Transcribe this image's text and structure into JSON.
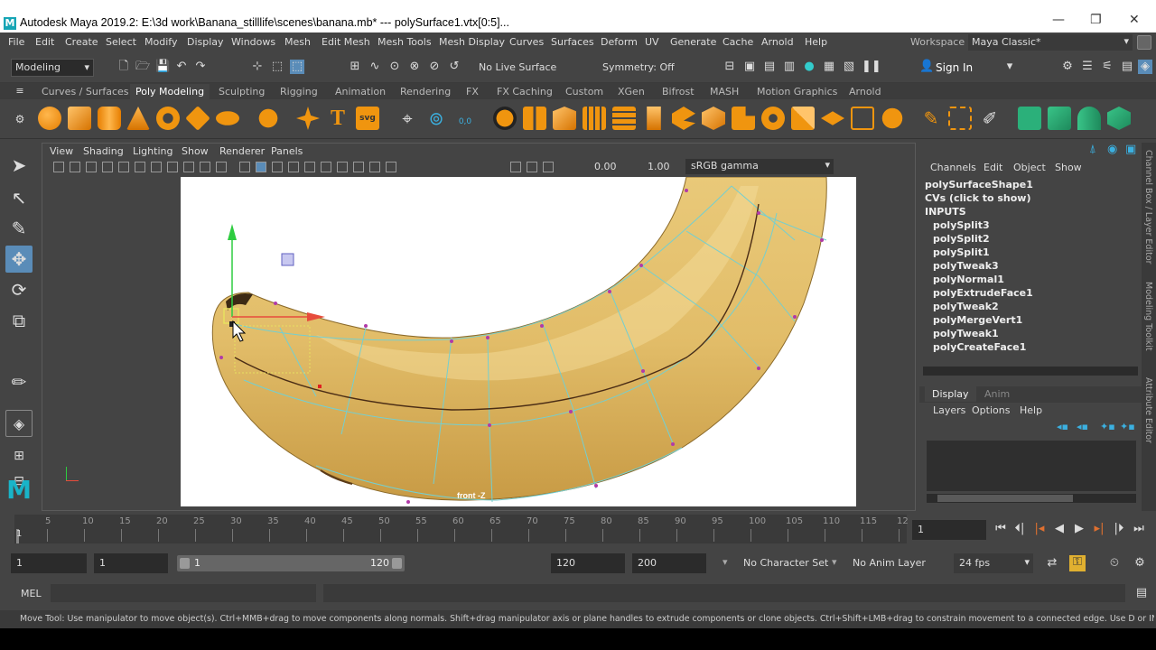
{
  "title": "Autodesk Maya 2019.2: E:\\3d work\\Banana_stilllife\\scenes\\banana.mb*  ---  polySurface1.vtx[0:5]...",
  "menus": [
    "File",
    "Edit",
    "Create",
    "Select",
    "Modify",
    "Display",
    "Windows",
    "Mesh",
    "Edit Mesh",
    "Mesh Tools",
    "Mesh Display",
    "Curves",
    "Surfaces",
    "Deform",
    "UV",
    "Generate",
    "Cache",
    "Arnold",
    "Help"
  ],
  "workspace_label": "Workspace :",
  "workspace_value": "Maya Classic*",
  "mode_value": "Modeling",
  "live_surface": "No Live Surface",
  "symmetry": "Symmetry: Off",
  "sign_in": "Sign In",
  "shelf_tabs": [
    "Curves / Surfaces",
    "Poly Modeling",
    "Sculpting",
    "Rigging",
    "Animation",
    "Rendering",
    "FX",
    "FX Caching",
    "Custom",
    "XGen",
    "Bifrost",
    "MASH",
    "Motion Graphics",
    "Arnold"
  ],
  "shelf_svg_label": "svg",
  "shelf_uv_label": "0,0",
  "viewport_menus": [
    "View",
    "Shading",
    "Lighting",
    "Show",
    "Renderer",
    "Panels"
  ],
  "viewport_value1": "0.00",
  "viewport_value2": "1.00",
  "viewport_color": "sRGB gamma",
  "camera_label": "front -Z",
  "channel_tabs": [
    "Channels",
    "Edit",
    "Object",
    "Show"
  ],
  "channel_title": "polySurfaceShape1",
  "channel_cvs": "CVs (click to show)",
  "inputs_label": "INPUTS",
  "inputs": [
    "polySplit3",
    "polySplit2",
    "polySplit1",
    "polyTweak3",
    "polyNormal1",
    "polyExtrudeFace1",
    "polyTweak2",
    "polyMergeVert1",
    "polyTweak1",
    "polyCreateFace1"
  ],
  "layer_tabs": [
    "Display",
    "Anim"
  ],
  "layer_menus": [
    "Layers",
    "Options",
    "Help"
  ],
  "side_tabs": [
    "Channel Box / Layer Editor",
    "Modeling Toolkit",
    "Attribute Editor"
  ],
  "timeline_ticks": [
    "5",
    "10",
    "15",
    "20",
    "25",
    "30",
    "35",
    "40",
    "45",
    "50",
    "55",
    "60",
    "65",
    "70",
    "75",
    "80",
    "85",
    "90",
    "95",
    "100",
    "105",
    "110",
    "115",
    "12"
  ],
  "timeline_start": "1",
  "current_frame": "1",
  "range_start": "1",
  "range_inner_start": "1",
  "range_slider_start": "1",
  "range_slider_end": "120",
  "range_end": "120",
  "range_outer_end": "200",
  "character_set": "No Character Set",
  "anim_layer": "No Anim Layer",
  "fps": "24 fps",
  "mel_label": "MEL",
  "help_line": "Move Tool: Use manipulator to move object(s). Ctrl+MMB+drag to move components along normals. Shift+drag manipulator axis or plane handles to extrude components or clone objects. Ctrl+Shift+LMB+drag to constrain movement to a connected edge. Use D or INSERT to change the pivot position a"
}
